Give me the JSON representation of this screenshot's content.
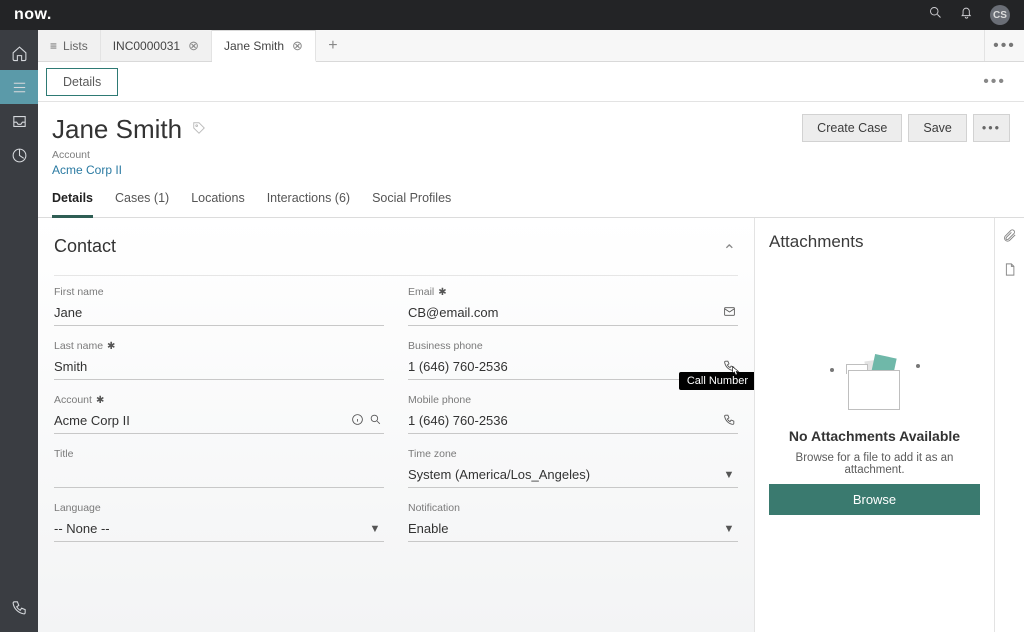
{
  "brand": {
    "logo": "now.",
    "avatar_initials": "CS"
  },
  "tabs": {
    "lists_label": "Lists",
    "items": [
      {
        "label": "INC0000031"
      },
      {
        "label": "Jane Smith"
      }
    ]
  },
  "section_tab": "Details",
  "header": {
    "title": "Jane Smith",
    "account_label": "Account",
    "account_link": "Acme Corp II",
    "create_case": "Create Case",
    "save": "Save"
  },
  "record_tabs": {
    "details": "Details",
    "cases": "Cases (1)",
    "locations": "Locations",
    "interactions": "Interactions (6)",
    "social": "Social Profiles"
  },
  "contact": {
    "heading": "Contact",
    "left": {
      "first_name_label": "First name",
      "first_name": "Jane",
      "last_name_label": "Last name",
      "last_name": "Smith",
      "account_label": "Account",
      "account": "Acme Corp II",
      "title_label": "Title",
      "title": "",
      "language_label": "Language",
      "language": "-- None --"
    },
    "right": {
      "email_label": "Email",
      "email": "CB@email.com",
      "bphone_label": "Business phone",
      "bphone": "1 (646) 760-2536",
      "mphone_label": "Mobile phone",
      "mphone": "1 (646) 760-2536",
      "tz_label": "Time zone",
      "tz": "System (America/Los_Angeles)",
      "notif_label": "Notification",
      "notif": "Enable"
    }
  },
  "tooltip": {
    "call_number": "Call Number"
  },
  "attachments": {
    "heading": "Attachments",
    "none_title": "No Attachments Available",
    "none_sub": "Browse for a file to add it as an attachment.",
    "browse": "Browse"
  }
}
